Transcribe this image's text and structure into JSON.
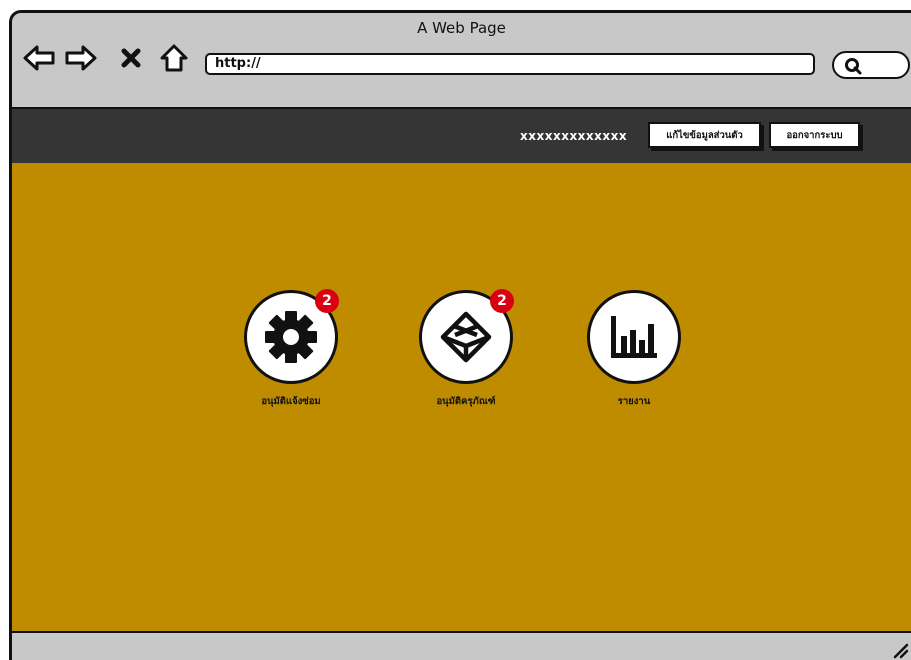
{
  "browser": {
    "title": "A Web Page",
    "url": "http://",
    "nav_icons": [
      "back-arrow-icon",
      "forward-arrow-icon",
      "close-icon",
      "home-icon"
    ],
    "search_icon": "search-icon"
  },
  "topbar": {
    "username": "xxxxxxxxxxxxx",
    "edit_profile_label": "แก้ไขข้อมูลส่วนตัว",
    "logout_label": "ออกจากระบบ"
  },
  "menu": [
    {
      "label": "อนุมัติแจ้งซ่อม",
      "icon": "gear-icon",
      "badge": "2"
    },
    {
      "label": "อนุมัติครุภัณฑ์",
      "icon": "box-icon",
      "badge": "2"
    },
    {
      "label": "รายงาน",
      "icon": "bar-chart-icon",
      "badge": null
    }
  ],
  "colors": {
    "main_background": "#bf8c00",
    "topbar_background": "#353535",
    "badge": "#d90012",
    "browser_chrome": "#c8c8c8"
  }
}
